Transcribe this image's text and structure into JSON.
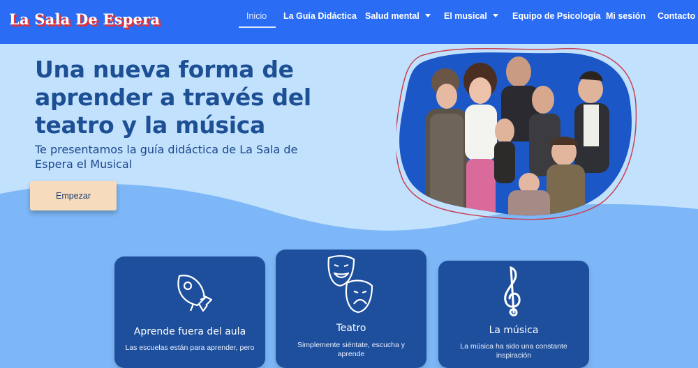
{
  "header": {
    "logo": "La Sala De Espera",
    "nav": [
      {
        "label": "Inicio",
        "active": true
      },
      {
        "label": "La Guía Didáctica"
      },
      {
        "label": "Salud mental",
        "dropdown": true
      },
      {
        "label": "El musical",
        "dropdown": true
      },
      {
        "label": "Equipo de Psicología"
      },
      {
        "label": "Mi sesión"
      },
      {
        "label": "Contacto"
      }
    ]
  },
  "hero": {
    "title": "Una nueva forma de aprender a través del teatro y la música",
    "subtitle": "Te presentamos la guía didáctica de La Sala de Espera el Musical",
    "button": "Empezar"
  },
  "cards": [
    {
      "icon": "rocket-icon",
      "title": "Aprende fuera del aula",
      "text": "Las escuelas están para aprender, pero"
    },
    {
      "icon": "theater-masks-icon",
      "title": "Teatro",
      "text": "Simplemente siéntate, escucha y aprende"
    },
    {
      "icon": "treble-clef-icon",
      "title": "La música",
      "text": "La música ha sido una constante inspiración"
    }
  ],
  "colors": {
    "header": "#2a6cf4",
    "hero_bg": "#c2e1fd",
    "section_bg": "#7db7f7",
    "card_bg": "#1d4f9d",
    "button_bg": "#f6dcbc",
    "title_text": "#1c4f94"
  }
}
